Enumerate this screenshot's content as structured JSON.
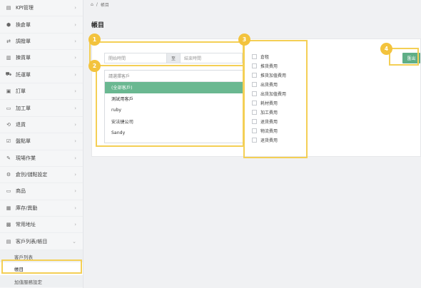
{
  "sidebar": {
    "items": [
      {
        "label": "KPI管理",
        "icon": "clipboard-icon",
        "glyph": "▤"
      },
      {
        "label": "換倉單",
        "icon": "cube-icon",
        "glyph": "⬢"
      },
      {
        "label": "調撥單",
        "icon": "swap-icon",
        "glyph": "⇄"
      },
      {
        "label": "揀貨單",
        "icon": "barcode-icon",
        "glyph": "▥"
      },
      {
        "label": "託運單",
        "icon": "truck-icon",
        "glyph": "⛟"
      },
      {
        "label": "訂單",
        "icon": "cart-icon",
        "glyph": "▣"
      },
      {
        "label": "加工單",
        "icon": "document-icon",
        "glyph": "▭"
      },
      {
        "label": "退貨",
        "icon": "return-icon",
        "glyph": "⟲"
      },
      {
        "label": "盤點單",
        "icon": "checklist-icon",
        "glyph": "☑"
      },
      {
        "label": "現場作業",
        "icon": "wrench-icon",
        "glyph": "✎"
      },
      {
        "label": "倉別/儲點設定",
        "icon": "gear-icon",
        "glyph": "⚙"
      },
      {
        "label": "商品",
        "icon": "folder-icon",
        "glyph": "▭"
      },
      {
        "label": "庫存/異動",
        "icon": "box-icon",
        "glyph": "▦"
      },
      {
        "label": "常用地址",
        "icon": "map-icon",
        "glyph": "▩"
      },
      {
        "label": "客戶列表/帳目",
        "icon": "ledger-icon",
        "glyph": "▤"
      }
    ],
    "subitems": [
      "客戶列表",
      "帳目",
      "加值服務設定"
    ]
  },
  "breadcrumb": {
    "home_glyph": "⌂",
    "separator": "/",
    "current": "帳目"
  },
  "page": {
    "title": "帳目"
  },
  "filters": {
    "start_placeholder": "開始時間",
    "separator": "至",
    "end_placeholder": "結束時間",
    "customer_placeholder": "請選擇客戶",
    "options": [
      "(全部客戶)",
      "測試用客戶",
      "ruby",
      "安法捷公司",
      "Sandy"
    ],
    "selected": "(全部客戶)"
  },
  "checkboxes": [
    "倉租",
    "推貨費用",
    "推貨加值費用",
    "出貨費用",
    "出貨加值費用",
    "耗材費用",
    "加工費用",
    "退貨費用",
    "物流費用",
    "退貨費用"
  ],
  "export_label": "匯出",
  "badges": [
    "1",
    "2",
    "3",
    "4"
  ],
  "colors": {
    "accent": "#5fae86",
    "highlight": "#f4cf55",
    "badge": "#f3c33d"
  }
}
